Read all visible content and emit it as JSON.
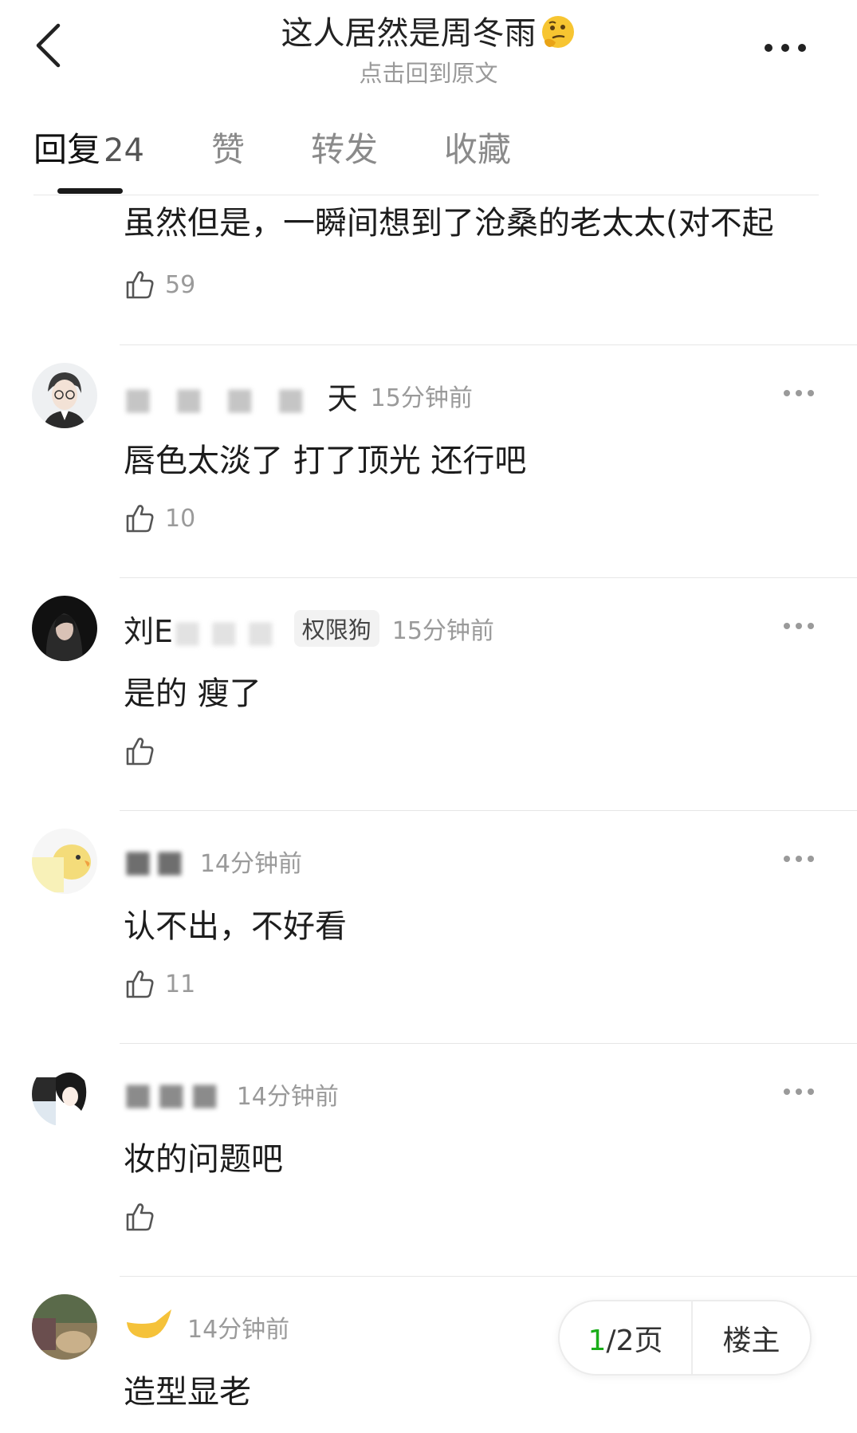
{
  "header": {
    "title": "这人居然是周冬雨",
    "title_emoji": "thinking-face-emoji",
    "subtitle": "点击回到原文"
  },
  "tabs": [
    {
      "label": "回复",
      "count": "24",
      "active": true
    },
    {
      "label": "赞"
    },
    {
      "label": "转发"
    },
    {
      "label": "收藏"
    }
  ],
  "comments": [
    {
      "text": "虽然但是，一瞬间想到了沧桑的老太太(对不起",
      "likes": "59"
    },
    {
      "username_visible": "天",
      "time": "15分钟前",
      "text": "唇色太淡了  打了顶光 还行吧",
      "likes": "10"
    },
    {
      "username_visible": "刘E",
      "badge": "权限狗",
      "time": "15分钟前",
      "text": "是的 瘦了",
      "likes": ""
    },
    {
      "username_visible": "",
      "time": "14分钟前",
      "text": "认不出，不好看",
      "likes": "11"
    },
    {
      "username_visible": "",
      "time": "14分钟前",
      "text": "妆的问题吧",
      "likes": ""
    },
    {
      "username_visible": "",
      "time": "14分钟前",
      "text": "造型显老"
    }
  ],
  "pager": {
    "current": "1",
    "total_suffix": "/2页",
    "op_label": "楼主"
  },
  "colors": {
    "accent_green": "#1aad19",
    "text_primary": "#1a1a1a",
    "text_secondary": "#9a9a9a"
  },
  "icons": {
    "back": "chevron-left-icon",
    "more": "more-dots-icon",
    "like": "thumbs-up-icon"
  }
}
